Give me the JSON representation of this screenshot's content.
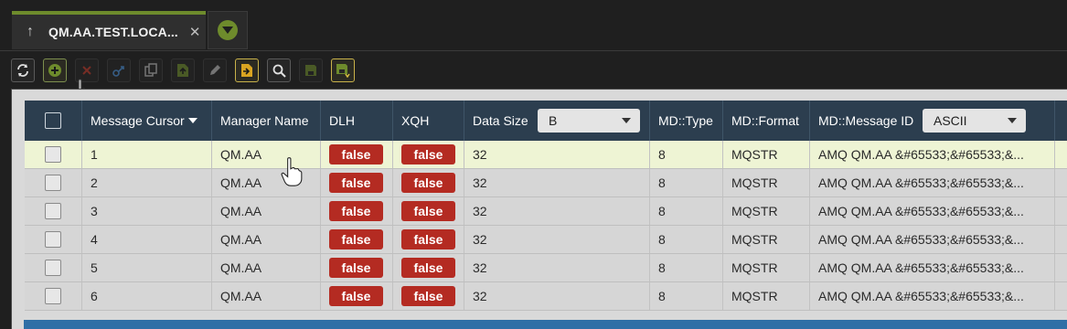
{
  "tab": {
    "title": "QM.AA.TEST.LOCA...",
    "close": "✕"
  },
  "toolbar": {
    "buttons": [
      {
        "name": "refresh-button",
        "icon": "refresh-icon"
      },
      {
        "name": "add-message-button",
        "icon": "plus-circle-icon"
      },
      {
        "name": "delete-button",
        "icon": "close-icon"
      },
      {
        "name": "move-button",
        "icon": "move-icon"
      },
      {
        "name": "copy-button",
        "icon": "copy-icon"
      },
      {
        "name": "export-button",
        "icon": "file-export-icon"
      },
      {
        "name": "edit-button",
        "icon": "pencil-icon"
      },
      {
        "name": "import-button",
        "icon": "file-import-icon"
      },
      {
        "name": "search-button",
        "icon": "search-icon"
      },
      {
        "name": "save-button",
        "icon": "save-icon"
      },
      {
        "name": "save-all-button",
        "icon": "save-download-icon"
      }
    ]
  },
  "grid": {
    "headers": {
      "message_cursor": "Message Cursor",
      "manager_name": "Manager Name",
      "dlh": "DLH",
      "xqh": "XQH",
      "data_size": "Data Size",
      "data_size_unit": "B",
      "md_type": "MD::Type",
      "md_format": "MD::Format",
      "md_message_id": "MD::Message ID",
      "md_message_id_enc": "ASCII"
    },
    "rows": [
      {
        "cursor": "1",
        "manager": "QM.AA",
        "dlh": "false",
        "xqh": "false",
        "size": "32",
        "type": "8",
        "format": "MQSTR",
        "msgid": "AMQ QM.AA &#65533;&#65533;&..."
      },
      {
        "cursor": "2",
        "manager": "QM.AA",
        "dlh": "false",
        "xqh": "false",
        "size": "32",
        "type": "8",
        "format": "MQSTR",
        "msgid": "AMQ QM.AA &#65533;&#65533;&..."
      },
      {
        "cursor": "3",
        "manager": "QM.AA",
        "dlh": "false",
        "xqh": "false",
        "size": "32",
        "type": "8",
        "format": "MQSTR",
        "msgid": "AMQ QM.AA &#65533;&#65533;&..."
      },
      {
        "cursor": "4",
        "manager": "QM.AA",
        "dlh": "false",
        "xqh": "false",
        "size": "32",
        "type": "8",
        "format": "MQSTR",
        "msgid": "AMQ QM.AA &#65533;&#65533;&..."
      },
      {
        "cursor": "5",
        "manager": "QM.AA",
        "dlh": "false",
        "xqh": "false",
        "size": "32",
        "type": "8",
        "format": "MQSTR",
        "msgid": "AMQ QM.AA &#65533;&#65533;&..."
      },
      {
        "cursor": "6",
        "manager": "QM.AA",
        "dlh": "false",
        "xqh": "false",
        "size": "32",
        "type": "8",
        "format": "MQSTR",
        "msgid": "AMQ QM.AA &#65533;&#65533;&..."
      }
    ]
  },
  "colors": {
    "accent": "#6e8b2c",
    "header": "#2c3e4f",
    "badge": "#b42b22",
    "selected_row": "#eef4d4",
    "bottom_bar": "#2f6fa6"
  }
}
